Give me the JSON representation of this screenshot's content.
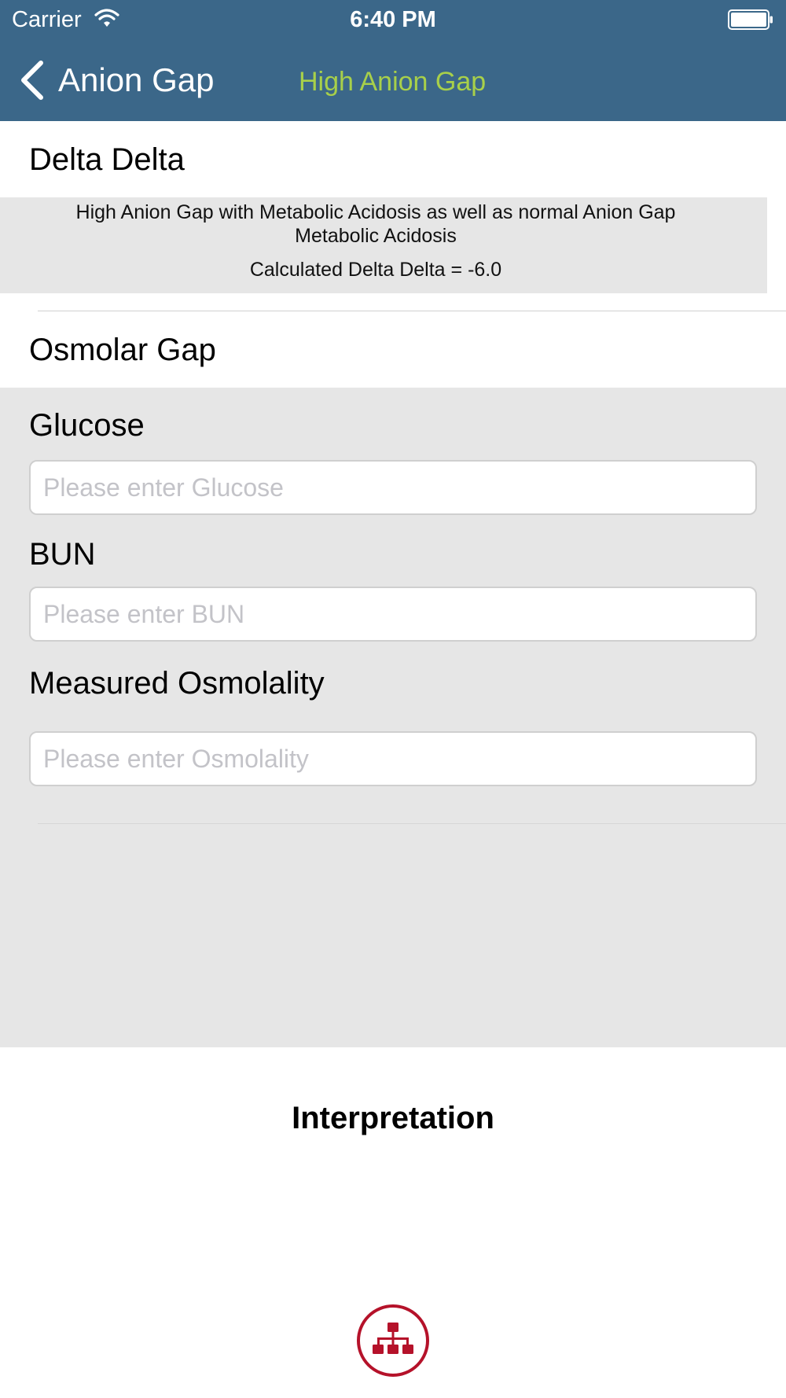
{
  "status_bar": {
    "carrier": "Carrier",
    "time": "6:40 PM",
    "wifi_icon": "wifi-icon",
    "battery_icon": "battery-icon"
  },
  "nav": {
    "back_label": "Anion Gap",
    "back_icon": "chevron-left-icon",
    "title": "High Anion Gap",
    "title_color": "#a8d04a",
    "bar_color": "#3b6789"
  },
  "delta_delta": {
    "header": "Delta Delta",
    "description": "High Anion Gap with Metabolic Acidosis as well as normal Anion Gap Metabolic Acidosis",
    "calculated": "Calculated Delta Delta = -6.0"
  },
  "osmolar_gap": {
    "header": "Osmolar Gap",
    "fields": [
      {
        "label": "Glucose",
        "placeholder": "Please enter Glucose",
        "value": ""
      },
      {
        "label": "BUN",
        "placeholder": "Please enter BUN",
        "value": ""
      },
      {
        "label": "Measured Osmolality",
        "placeholder": "Please enter Osmolality",
        "value": ""
      }
    ]
  },
  "interpretation": {
    "title": "Interpretation",
    "button_icon": "sitemap-icon",
    "button_color": "#b5122a"
  }
}
